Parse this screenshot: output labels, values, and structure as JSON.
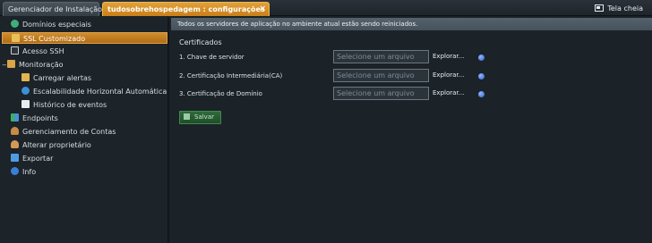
{
  "tabs": [
    {
      "label": "Gerenciador de Instalação",
      "active": false
    },
    {
      "label": "tudosobrehospedagem : configurações",
      "active": true,
      "close": "×"
    }
  ],
  "fullscreen_label": "Tela cheia",
  "sidebar": {
    "items": [
      {
        "label": "Domínios especiais",
        "icon": "globe-icon"
      },
      {
        "label": "SSL Customizado",
        "icon": "lock-icon",
        "selected": true
      },
      {
        "label": "Acesso SSH",
        "icon": "terminal-icon"
      },
      {
        "label": "Monitoração",
        "icon": "monitor-icon"
      },
      {
        "label": "Carregar alertas",
        "icon": "alert-icon"
      },
      {
        "label": "Escalabilidade Horizontal Automática",
        "icon": "scaling-icon"
      },
      {
        "label": "Histórico de eventos",
        "icon": "history-icon"
      },
      {
        "label": "Endpoints",
        "icon": "endpoints-icon"
      },
      {
        "label": "Gerenciamento de Contas",
        "icon": "accounts-icon"
      },
      {
        "label": "Alterar proprietário",
        "icon": "owner-icon"
      },
      {
        "label": "Exportar",
        "icon": "export-icon"
      },
      {
        "label": "Info",
        "icon": "info-icon"
      }
    ]
  },
  "main": {
    "notice": "Todos os servidores de aplicação no ambiente atual estão sendo reiniciados.",
    "section_title": "Certificados",
    "rows": [
      {
        "label": "1. Chave de servidor",
        "placeholder": "Selecione um arquivo",
        "browse": "Explorar..."
      },
      {
        "label": "2. Certificação Intermediária(CA)",
        "placeholder": "Selecione um arquivo",
        "browse": "Explorar..."
      },
      {
        "label": "3. Certificação de Domínio",
        "placeholder": "Selecione um arquivo",
        "browse": "Explorar..."
      }
    ],
    "save_label": "Salvar"
  },
  "colors": {
    "accent": "#d08a26",
    "notice_bg": "#4f5b64",
    "save_bg": "#2a6133"
  }
}
